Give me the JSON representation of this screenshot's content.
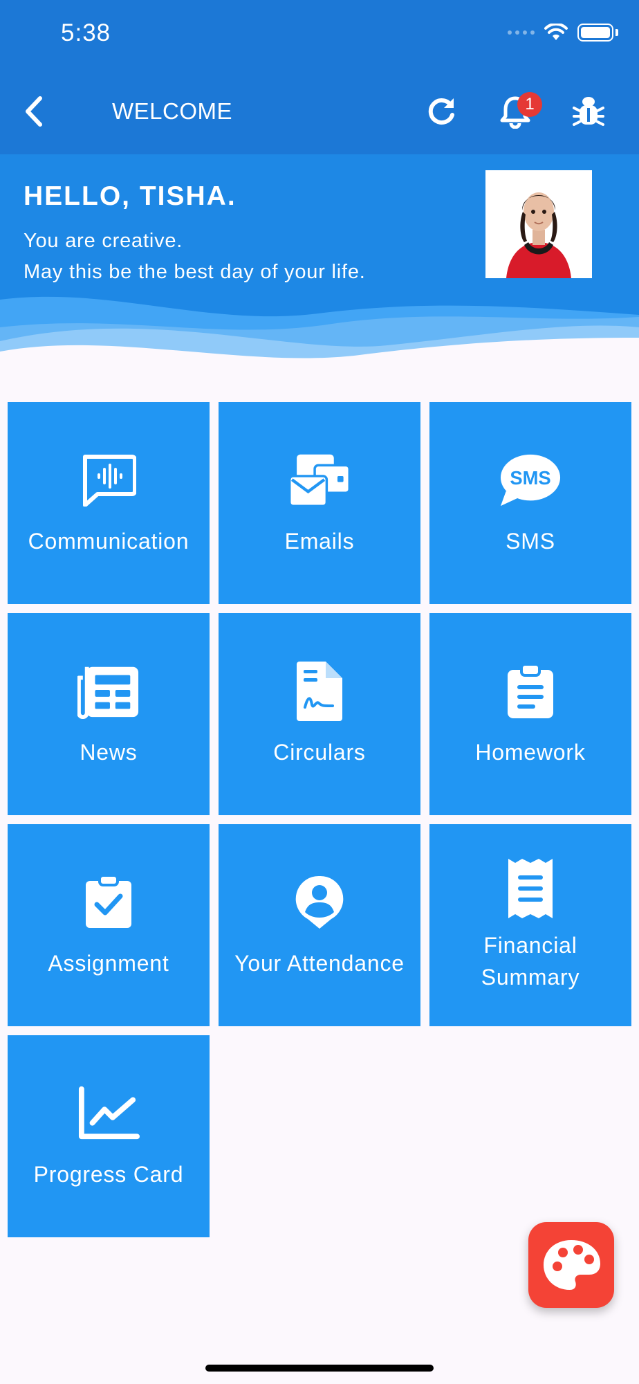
{
  "status_bar": {
    "time": "5:38"
  },
  "header": {
    "title": "WELCOME",
    "notification_count": "1"
  },
  "hero": {
    "greeting": "HELLO, TISHA.",
    "line1": "You are creative.",
    "line2": "May this be the best day of your life."
  },
  "tiles": [
    {
      "label": "Communication",
      "icon": "audio-chat-icon"
    },
    {
      "label": "Emails",
      "icon": "mail-stack-icon"
    },
    {
      "label": "SMS",
      "icon": "sms-bubble-icon"
    },
    {
      "label": "News",
      "icon": "newspaper-icon"
    },
    {
      "label": "Circulars",
      "icon": "signed-document-icon"
    },
    {
      "label": "Homework",
      "icon": "clipboard-list-icon"
    },
    {
      "label": "Assignment",
      "icon": "clipboard-check-icon"
    },
    {
      "label": "Your Attendance",
      "icon": "user-pin-icon"
    },
    {
      "label": "Financial Summary",
      "icon": "receipt-icon"
    },
    {
      "label": "Progress Card",
      "icon": "line-chart-icon"
    }
  ],
  "colors": {
    "app_bar": "#1c78d6",
    "hero": "#1e88e5",
    "tile": "#2196f3",
    "fab": "#f44336",
    "badge": "#e53935"
  }
}
